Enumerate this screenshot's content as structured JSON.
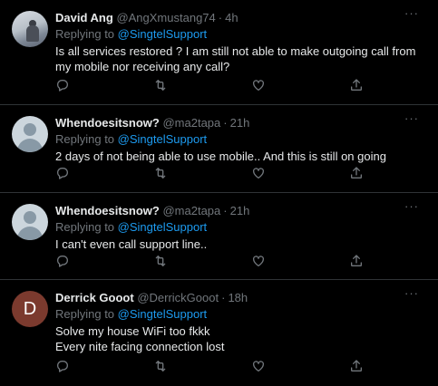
{
  "tweets": [
    {
      "name": "David Ang",
      "handle": "@AngXmustang74",
      "time": "4h",
      "replying_prefix": "Replying to ",
      "replying_to": "@SingtelSupport",
      "text": "Is all services restored ? I am still not able to make outgoing call from my mobile nor receiving any call?",
      "avatar": "photo"
    },
    {
      "name": "Whendoesitsnow?",
      "handle": "@ma2tapa",
      "time": "21h",
      "replying_prefix": "Replying to ",
      "replying_to": "@SingtelSupport",
      "text": "2 days of not being able to use mobile.. And this is still on going",
      "avatar": "default"
    },
    {
      "name": "Whendoesitsnow?",
      "handle": "@ma2tapa",
      "time": "21h",
      "replying_prefix": "Replying to ",
      "replying_to": "@SingtelSupport",
      "text": "I can't even call support line..",
      "avatar": "default"
    },
    {
      "name": "Derrick Gooot",
      "handle": "@DerrickGooot",
      "time": "18h",
      "replying_prefix": "Replying to ",
      "replying_to": "@SingtelSupport",
      "text_lines": [
        "Solve my house WiFi too fkkk",
        "Every nite facing connection lost"
      ],
      "avatar": "letter",
      "avatar_letter": "D"
    }
  ],
  "separator": "·",
  "more_glyph": "···",
  "colors": {
    "background": "#000000",
    "text": "#e7e9ea",
    "secondary": "#71767b",
    "link": "#1d9bf0",
    "divider": "#2f3336",
    "letter_avatar": "#7b3a2e"
  },
  "icons": [
    "reply-icon",
    "retweet-icon",
    "like-icon",
    "share-icon",
    "more-icon"
  ]
}
